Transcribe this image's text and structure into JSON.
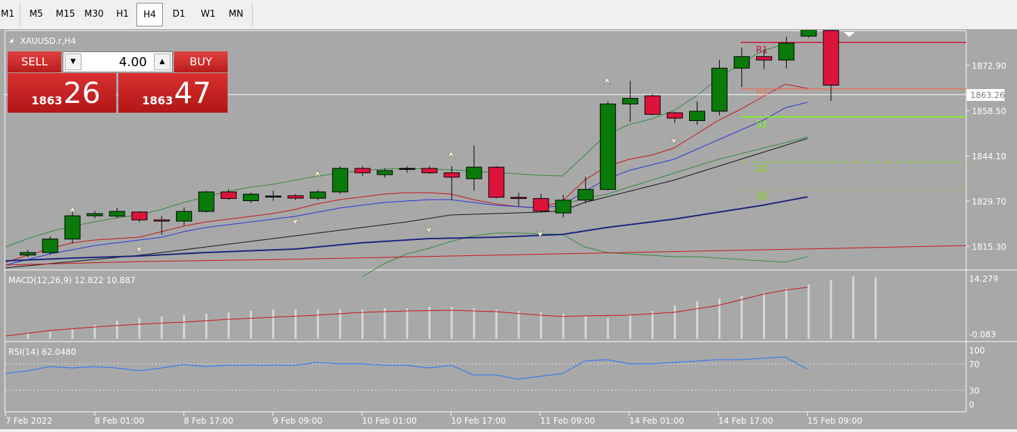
{
  "timeframes": [
    "M1",
    "M5",
    "M15",
    "M30",
    "H1",
    "H4",
    "D1",
    "W1",
    "MN"
  ],
  "active_timeframe": "H4",
  "chart": {
    "symbol_label": "XAUUSD.r,H4",
    "current_price_label": "1863.26",
    "price_ticks": [
      "1872.90",
      "1858.50",
      "1844.10",
      "1829.70",
      "1815.30"
    ],
    "pivot_labels": {
      "r1": "R1",
      "pp": "PP",
      "s1": "S1",
      "s2": "S2",
      "s3": "S3"
    },
    "time_labels": [
      "7 Feb 2022",
      "8 Feb 01:00",
      "8 Feb 17:00",
      "9 Feb 09:00",
      "10 Feb 01:00",
      "10 Feb 17:00",
      "11 Feb 09:00",
      "14 Feb 01:00",
      "14 Feb 17:00",
      "15 Feb 09:00"
    ]
  },
  "trade_panel": {
    "sell_label": "SELL",
    "buy_label": "BUY",
    "lot_value": "4.00",
    "bid_small": "1863",
    "bid_big": "26",
    "ask_small": "1863",
    "ask_big": "47"
  },
  "macd": {
    "label": "MACD(12,26,9) 12.822 10.887",
    "ticks": [
      "14.279",
      "-0.083"
    ]
  },
  "rsi": {
    "label": "RSI(14) 62.0480",
    "ticks": [
      "100",
      "70",
      "30",
      "0"
    ]
  },
  "colors": {
    "bull": "#0a7a0a",
    "bear": "#dc143c",
    "chart_bg": "#a8a8a8"
  },
  "chart_data": {
    "type": "candlestick",
    "candles": [
      [
        1812.5,
        1814.2,
        1811.8,
        1813.3
      ],
      [
        1813.3,
        1818.4,
        1812.6,
        1817.6
      ],
      [
        1817.6,
        1826.3,
        1816.2,
        1825.0
      ],
      [
        1825.0,
        1826.5,
        1824.2,
        1825.7
      ],
      [
        1824.9,
        1827.5,
        1824.2,
        1826.4
      ],
      [
        1826.2,
        1826.5,
        1823.0,
        1823.7
      ],
      [
        1823.7,
        1825.0,
        1819.0,
        1823.3
      ],
      [
        1823.3,
        1827.7,
        1822.0,
        1826.4
      ],
      [
        1826.4,
        1833.0,
        1826.0,
        1832.6
      ],
      [
        1832.6,
        1833.4,
        1830.0,
        1830.5
      ],
      [
        1829.8,
        1832.4,
        1829.1,
        1831.9
      ],
      [
        1831.3,
        1833.0,
        1829.8,
        1831.3
      ],
      [
        1831.4,
        1831.9,
        1830.0,
        1830.6
      ],
      [
        1830.6,
        1833.3,
        1830.0,
        1832.6
      ],
      [
        1832.6,
        1840.8,
        1832.0,
        1840.1
      ],
      [
        1840.1,
        1840.8,
        1837.7,
        1838.7
      ],
      [
        1838.1,
        1840.1,
        1837.2,
        1839.4
      ],
      [
        1840.1,
        1840.8,
        1838.7,
        1840.1
      ],
      [
        1840.1,
        1840.8,
        1838.4,
        1838.7
      ],
      [
        1838.7,
        1840.8,
        1830.0,
        1837.3
      ],
      [
        1836.8,
        1847.4,
        1833.0,
        1840.5
      ],
      [
        1840.5,
        1840.8,
        1830.5,
        1830.9
      ],
      [
        1830.9,
        1832.4,
        1828.0,
        1830.5
      ],
      [
        1830.5,
        1832.0,
        1826.0,
        1826.5
      ],
      [
        1825.9,
        1831.7,
        1824.5,
        1830.0
      ],
      [
        1830.0,
        1837.4,
        1829.0,
        1833.4
      ],
      [
        1833.4,
        1861.4,
        1833.0,
        1860.6
      ],
      [
        1860.6,
        1868.0,
        1855.0,
        1862.4
      ],
      [
        1863.2,
        1863.7,
        1857.0,
        1857.3
      ],
      [
        1857.8,
        1858.1,
        1854.6,
        1856.1
      ],
      [
        1855.3,
        1861.4,
        1854.0,
        1858.3
      ],
      [
        1858.3,
        1874.6,
        1857.0,
        1872.0
      ],
      [
        1872.0,
        1878.6,
        1866.0,
        1875.7
      ],
      [
        1875.7,
        1878.0,
        1871.7,
        1874.6
      ],
      [
        1874.6,
        1882.0,
        1871.9,
        1880.0
      ],
      [
        1882.2,
        1884.7,
        1881.7,
        1884.3
      ],
      [
        1884.0,
        1884.7,
        1861.6,
        1866.6
      ]
    ]
  }
}
